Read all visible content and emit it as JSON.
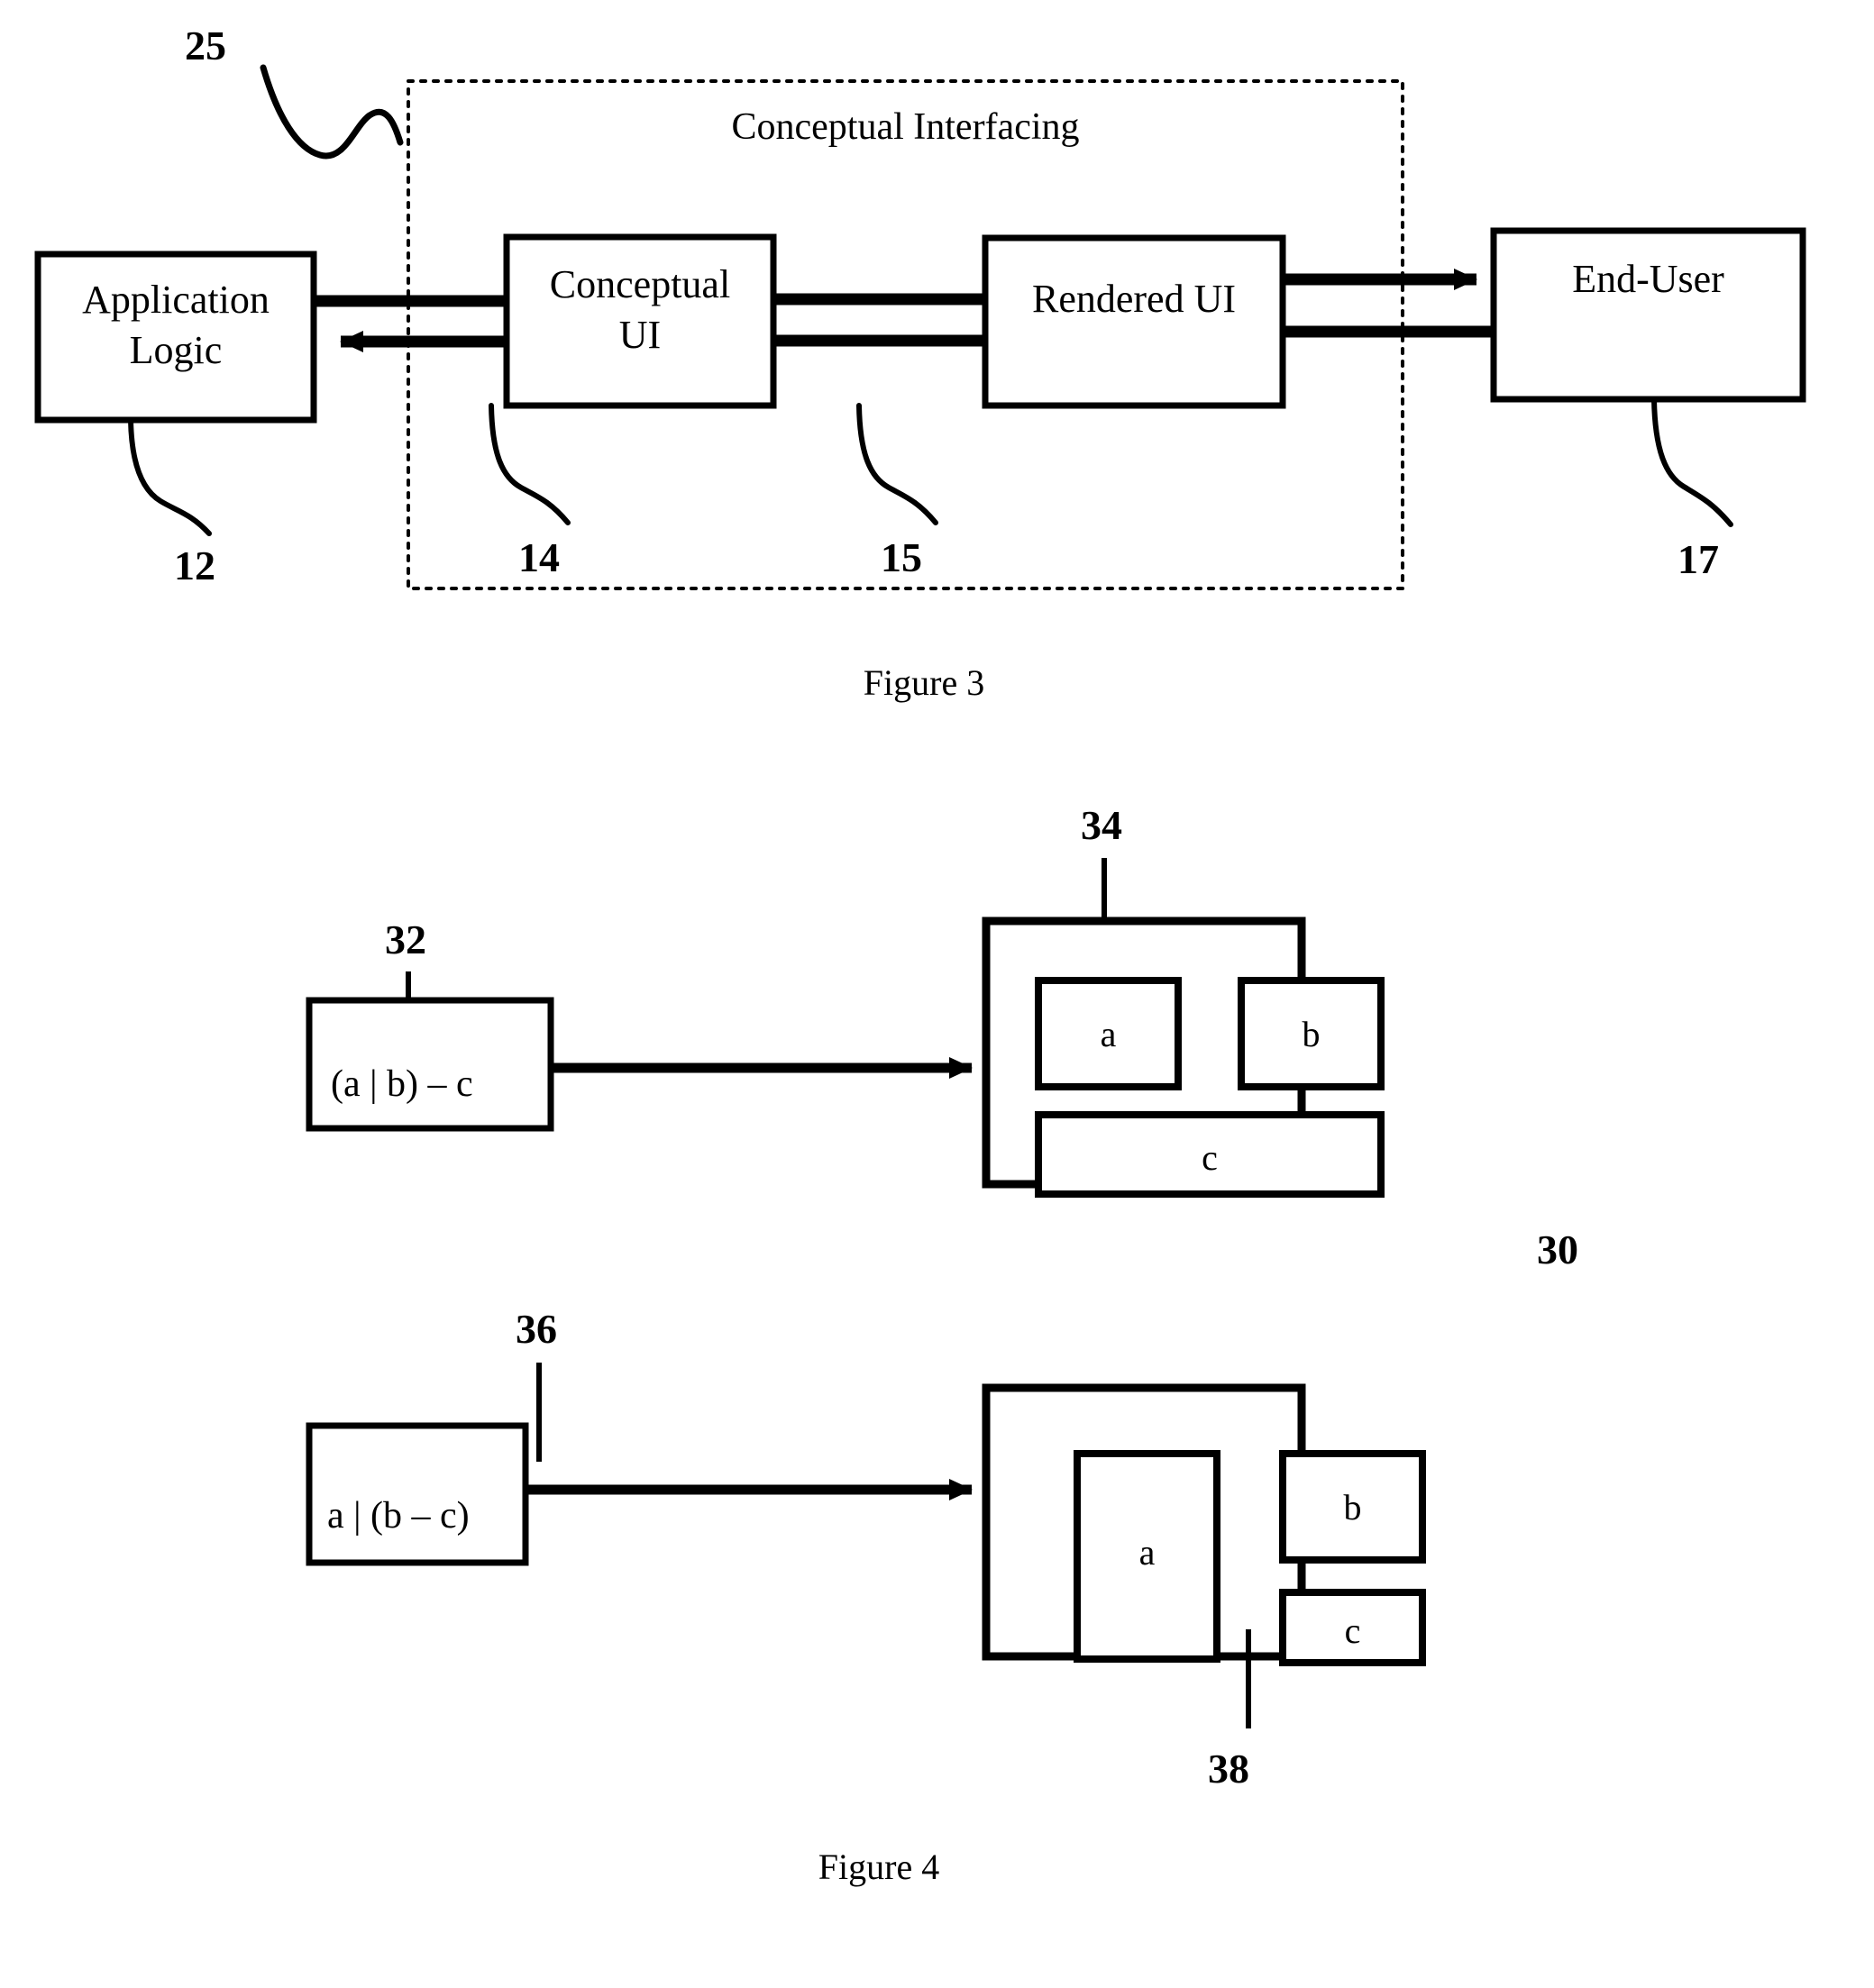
{
  "figure3": {
    "caption": "Figure 3",
    "dashed_region_title": "Conceptual Interfacing",
    "callout_25": "25",
    "boxes": [
      {
        "id": "application-logic",
        "line1": "Application",
        "line2": "Logic",
        "ref": "12"
      },
      {
        "id": "conceptual-ui",
        "line1": "Conceptual",
        "line2": "UI",
        "ref": "14"
      },
      {
        "id": "rendered-ui",
        "line1": "Rendered UI",
        "line2": "",
        "ref": "15"
      },
      {
        "id": "end-user",
        "line1": "End-User",
        "line2": "",
        "ref": "17"
      }
    ]
  },
  "figure4": {
    "caption": "Figure 4",
    "overall_ref": "30",
    "example_top": {
      "expression": "(a | b) – c",
      "expression_ref": "32",
      "container_ref": "34",
      "panels": [
        {
          "label": "a"
        },
        {
          "label": "b"
        },
        {
          "label": "c"
        }
      ]
    },
    "example_bottom": {
      "expression": "a | (b – c)",
      "expression_ref": "36",
      "container_ref": "38",
      "panels": [
        {
          "label": "a"
        },
        {
          "label": "b"
        },
        {
          "label": "c"
        }
      ]
    }
  }
}
